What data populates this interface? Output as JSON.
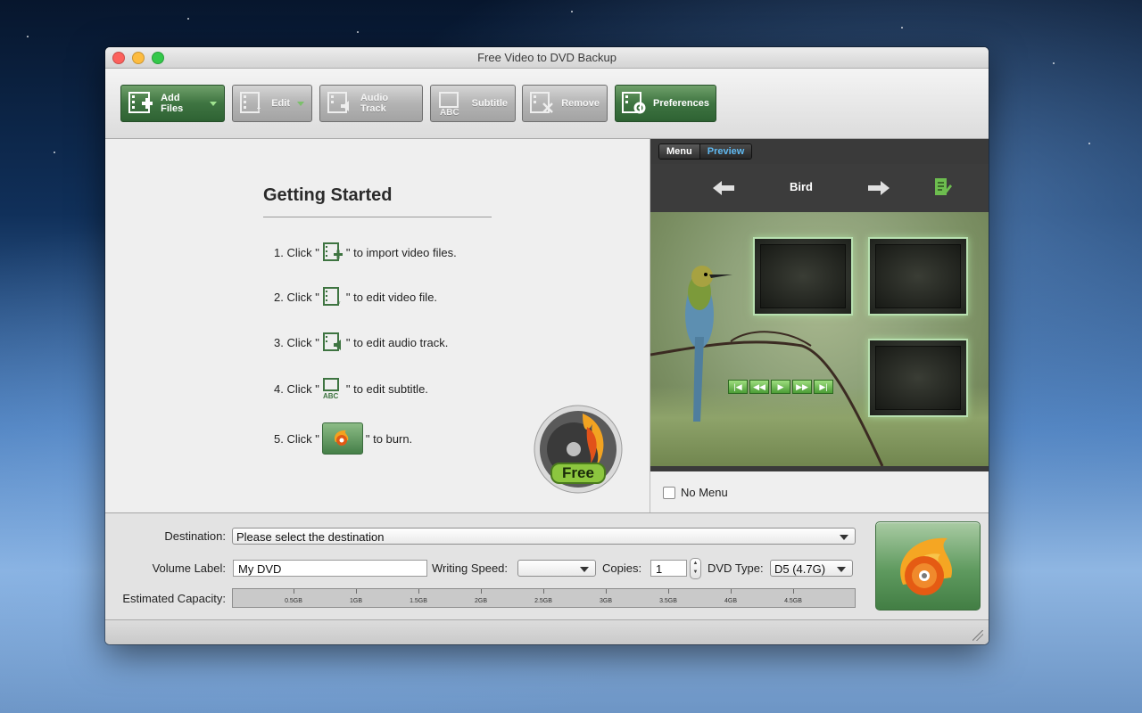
{
  "window": {
    "title": "Free Video to DVD Backup"
  },
  "toolbar": {
    "add_files": "Add Files",
    "edit": "Edit",
    "audio_track": "Audio Track",
    "subtitle": "Subtitle",
    "remove": "Remove",
    "preferences": "Preferences"
  },
  "getting_started": {
    "title": "Getting Started",
    "steps": [
      {
        "prefix": "1. Click \"",
        "suffix": "\" to import video files."
      },
      {
        "prefix": "2. Click \"",
        "suffix": "\" to edit video file."
      },
      {
        "prefix": "3. Click \"",
        "suffix": "\" to edit audio track."
      },
      {
        "prefix": "4. Click \"",
        "suffix": "\" to edit subtitle."
      },
      {
        "prefix": "5. Click \"",
        "suffix": "\" to burn."
      }
    ],
    "badge_text": "Free"
  },
  "preview_panel": {
    "tab_menu": "Menu",
    "tab_preview": "Preview",
    "menu_title": "Bird",
    "no_menu_label": "No Menu"
  },
  "bottom": {
    "destination_label": "Destination:",
    "destination_value": "Please select the destination",
    "volume_label": "Volume Label:",
    "volume_value": "My DVD",
    "writing_speed_label": "Writing Speed:",
    "writing_speed_value": "",
    "copies_label": "Copies:",
    "copies_value": "1",
    "dvd_type_label": "DVD Type:",
    "dvd_type_value": "D5 (4.7G)",
    "capacity_label": "Estimated Capacity:",
    "capacity_ticks": [
      "0.5GB",
      "1GB",
      "1.5GB",
      "2GB",
      "2.5GB",
      "3GB",
      "3.5GB",
      "4GB",
      "4.5GB"
    ]
  },
  "colors": {
    "accent_green": "#3e7441",
    "preview_tab_blue": "#5fb8f0"
  }
}
